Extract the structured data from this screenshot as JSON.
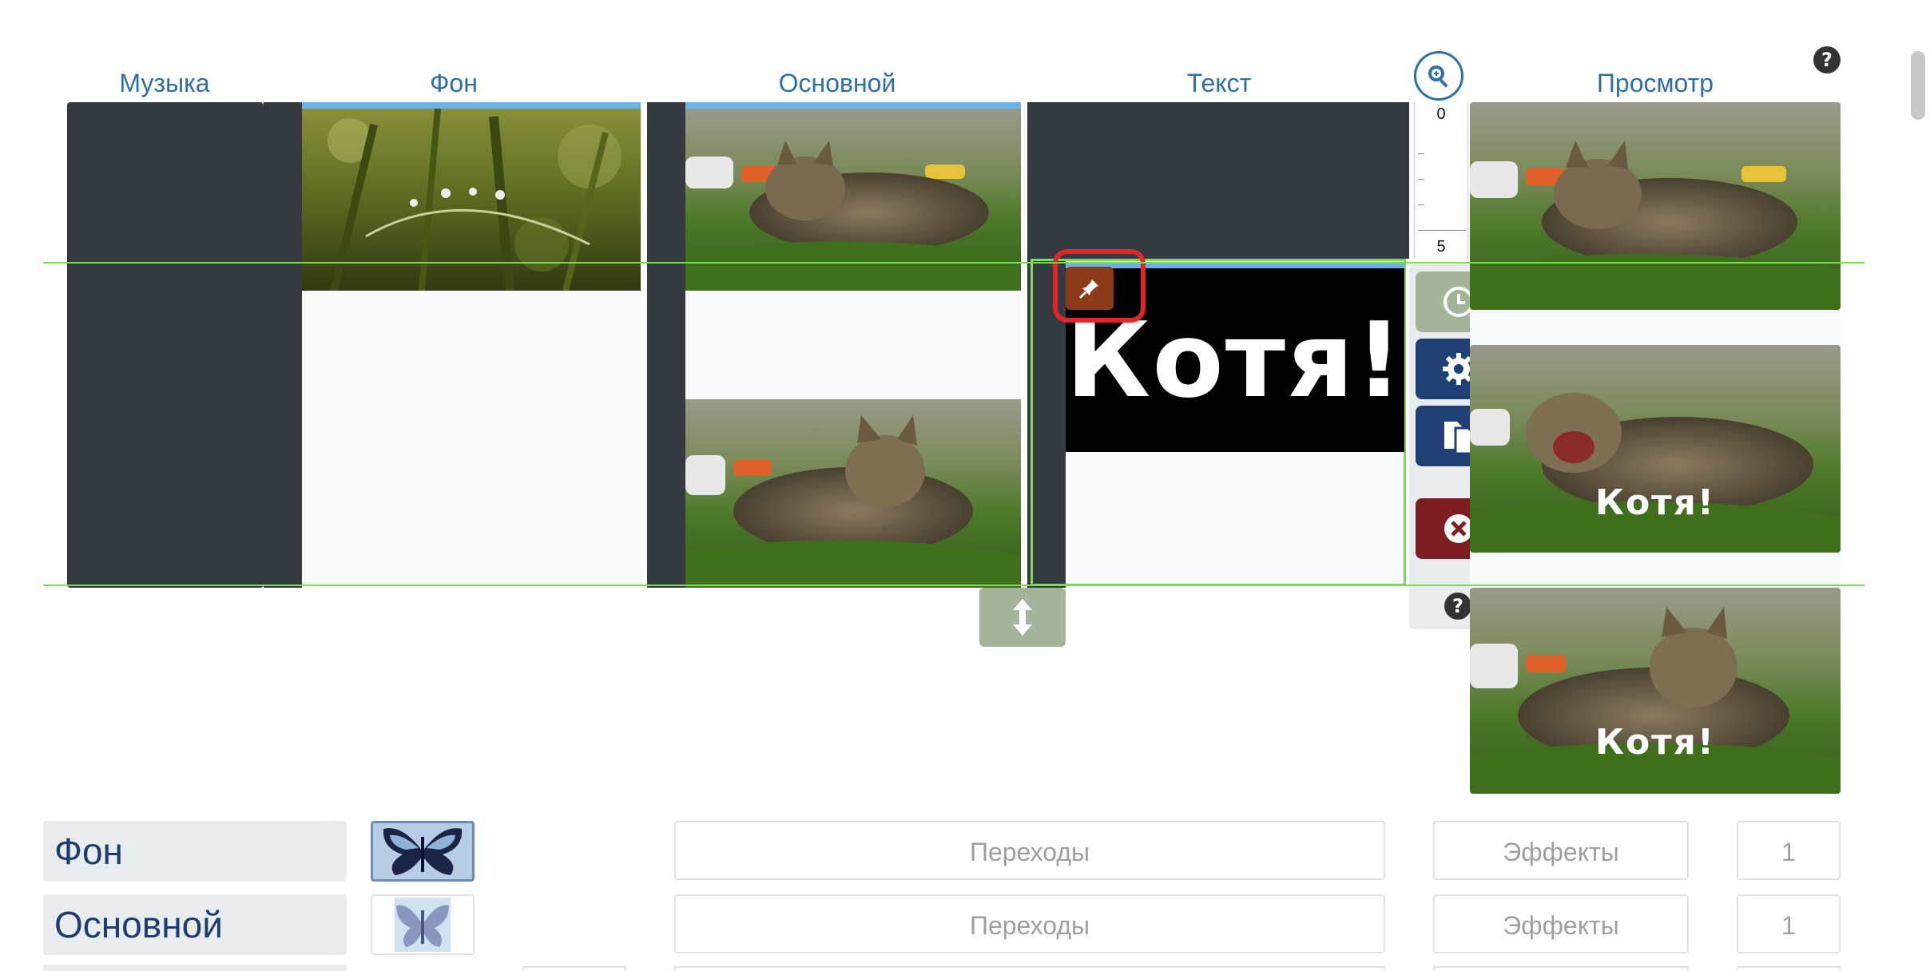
{
  "columns": {
    "music": "Музыка",
    "background": "Фон",
    "main": "Основной",
    "text": "Текст",
    "preview": "Просмотр"
  },
  "ruler": {
    "start": "0",
    "end": "5"
  },
  "text_clip": {
    "caption": "Котя!"
  },
  "preview_caption": "Котя!",
  "side_menu": {
    "buttons": [
      "clock-icon",
      "gear-icon",
      "copy-icon",
      "close-icon",
      "help-icon"
    ]
  },
  "help_glyph": "?",
  "rows": [
    {
      "label": "Фон",
      "transitions": "Переходы",
      "effects": "Эффекты",
      "count": "1"
    },
    {
      "label": "Основной",
      "transitions": "Переходы",
      "effects": "Эффекты",
      "count": "1"
    }
  ],
  "colors": {
    "accent_blue": "#2f6fa8",
    "dark_track": "#343a40",
    "pin_button": "#8b3a1a",
    "highlight_ring": "#e0262b",
    "clock_button": "#a4b49a",
    "settings_button": "#1f3f75",
    "delete_button": "#7d1f22",
    "guide_line": "#7ed957"
  }
}
